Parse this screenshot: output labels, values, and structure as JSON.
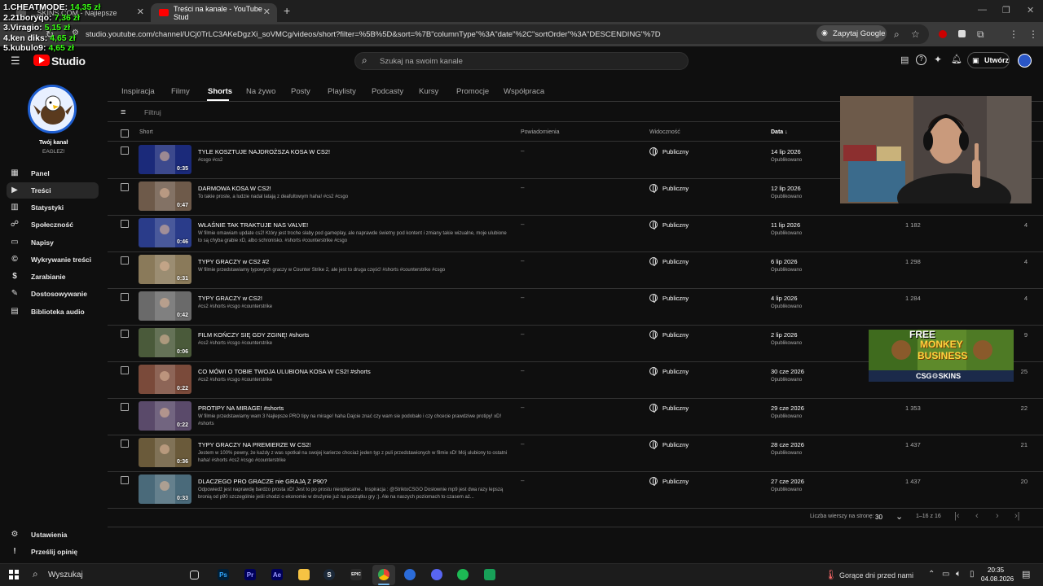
{
  "browser": {
    "tabs": [
      {
        "label": "...SKINS.COM - Najlepsze"
      },
      {
        "label": "Treści na kanale - YouTube Stud"
      }
    ],
    "new_tab": "+",
    "url": "studio.youtube.com/channel/UCj0TrLC3AKeDgzXi_soVMCg/videos/short?filter=%5B%5D&sort=%7B\"columnType\"%3A\"date\"%2C\"sortOrder\"%3A\"DESCENDING\"%7D",
    "ask_google": "Zapytaj Google"
  },
  "leaderboard": [
    {
      "rank_name": "1.CHEATMODE:",
      "amount": "14,35 zł"
    },
    {
      "rank_name": "2.21boryqo:",
      "amount": "7,36 zł"
    },
    {
      "rank_name": "3.Viragio:",
      "amount": "5,15 zł"
    },
    {
      "rank_name": "4.ken diks:",
      "amount": "4,65 zł"
    },
    {
      "rank_name": "5.kubulo9:",
      "amount": "4,65 zł"
    }
  ],
  "header": {
    "logo_text": "Studio",
    "search_placeholder": "Szukaj na swoim kanale",
    "create_label": "Utwórz"
  },
  "channel": {
    "label": "Twój kanał",
    "name": "EAGLEZ!"
  },
  "sidebar": {
    "items": [
      {
        "label": "Panel",
        "icon": "dashboard-icon"
      },
      {
        "label": "Treści",
        "icon": "content-icon",
        "active": true
      },
      {
        "label": "Statystyki",
        "icon": "analytics-icon"
      },
      {
        "label": "Społeczność",
        "icon": "community-icon"
      },
      {
        "label": "Napisy",
        "icon": "subtitles-icon"
      },
      {
        "label": "Wykrywanie treści",
        "icon": "copyright-icon"
      },
      {
        "label": "Zarabianie",
        "icon": "monetization-icon"
      },
      {
        "label": "Dostosowywanie",
        "icon": "customization-icon"
      },
      {
        "label": "Biblioteka audio",
        "icon": "audio-library-icon"
      }
    ],
    "bottom": [
      {
        "label": "Ustawienia",
        "icon": "settings-icon"
      },
      {
        "label": "Prześlij opinię",
        "icon": "feedback-icon"
      }
    ]
  },
  "content_tabs": [
    "Inspiracja",
    "Filmy",
    "Shorts",
    "Na żywo",
    "Posty",
    "Playlisty",
    "Podcasty",
    "Kursy",
    "Promocje",
    "Współpraca"
  ],
  "filter_placeholder": "Filtruj",
  "table": {
    "columns": {
      "short": "Short",
      "notifications": "Powiadomienia",
      "visibility": "Widoczność",
      "date": "Data ↓"
    },
    "rows": [
      {
        "title": "TYLE KOSZTUJE NAJDROŻSZA KOSA W CS2!",
        "desc": "#csgo #cs2",
        "duration": "0:35",
        "notif": "–",
        "visibility": "Publiczny",
        "date": "14 lip 2026",
        "status": "Opublikowano",
        "views": "",
        "comments": ""
      },
      {
        "title": "DARMOWA KOSA W CS2!",
        "desc": "To takie proste, a ludzie nadal latają z deafultowym haha! #cs2 #csgo",
        "duration": "0:47",
        "notif": "–",
        "visibility": "Publiczny",
        "date": "12 lip 2026",
        "status": "Opublikowano",
        "views": "",
        "comments": ""
      },
      {
        "title": "WŁAŚNIE TAK TRAKTUJE NAS VALVE!",
        "desc": "W filmie omawiam update cs2! Który jest troche słaby pod gameplay, ale naprawde świetny pod kontent i zmiany takie wizualne, moje ulubione to są chyba grabie xD, albo schronisko. #shorts #counterstrike #csgo",
        "duration": "0:46",
        "notif": "–",
        "visibility": "Publiczny",
        "date": "11 lip 2026",
        "status": "Opublikowano",
        "views": "1 182",
        "comments": "4"
      },
      {
        "title": "TYPY GRACZY w CS2 #2",
        "desc": "W filmie przedstawiamy typowych graczy w Counter Strike 2, ale jest to druga część! #shorts #counterstrike #csgo",
        "duration": "0:31",
        "notif": "–",
        "visibility": "Publiczny",
        "date": "6 lip 2026",
        "status": "Opublikowano",
        "views": "1 298",
        "comments": "4"
      },
      {
        "title": "TYPY GRACZY w CS2!",
        "desc": "#cs2 #shorts #csgo #counterstrike",
        "duration": "0:42",
        "notif": "–",
        "visibility": "Publiczny",
        "date": "4 lip 2026",
        "status": "Opublikowano",
        "views": "1 284",
        "comments": "4"
      },
      {
        "title": "FILM KOŃCZY SIĘ GDY ZGINĘ! #shorts",
        "desc": "#cs2 #shorts #csgo #counterstrike",
        "duration": "0:06",
        "notif": "–",
        "visibility": "Publiczny",
        "date": "2 lip 2026",
        "status": "Opublikowano",
        "views": "",
        "comments": "9"
      },
      {
        "title": "CO MÓWI O TOBIE TWOJA ULUBIONA KOSA W CS2! #shorts",
        "desc": "#cs2 #shorts #csgo #counterstrike",
        "duration": "0:22",
        "notif": "–",
        "visibility": "Publiczny",
        "date": "30 cze 2026",
        "status": "Opublikowano",
        "views": "",
        "comments": "25"
      },
      {
        "title": "PROTIPY NA MIRAGE! #shorts",
        "desc": "W filmie przedstawiamy wam 3 Najlepsze PRO tipy na mirage! haha Dajcie znać czy wam sie podobało i czy chcecie prawdziwe protipy! xD! #shorts",
        "duration": "0:22",
        "notif": "–",
        "visibility": "Publiczny",
        "date": "29 cze 2026",
        "status": "Opublikowano",
        "views": "1 353",
        "comments": "22"
      },
      {
        "title": "TYPY GRACZY NA PREMIERZE W CS2!",
        "desc": "Jestem w 100% pewny, że każdy z was spotkał na swojej karierze chociaż jeden typ z puli przedstawionych w filmie xD! Mój ulubiony to ostatni haha! #shorts #cs2 #csgo #counterstrike",
        "duration": "0:36",
        "notif": "–",
        "visibility": "Publiczny",
        "date": "28 cze 2026",
        "status": "Opublikowano",
        "views": "1 437",
        "comments": "21"
      },
      {
        "title": "DLACZEGO PRO GRACZE nie GRAJĄ Z P90?",
        "desc": "Odpowiedź jest naprawdę bardzo prosta xD! Jest to po prostu nieopłacalne.. Inspiracja : @StriktoCSGO Dosłownie mp9 jest dwa razy lepszą bronią od p90 szczególnie jeśli chodzi o ekonomie w drużynie już na początku gry ;). Ale na naszych poziomach to czasem aż...",
        "duration": "0:33",
        "notif": "–",
        "visibility": "Publiczny",
        "date": "27 cze 2026",
        "status": "Opublikowano",
        "views": "1 437",
        "comments": "20"
      }
    ]
  },
  "pagination": {
    "rows_label": "Liczba wierszy na stronę:",
    "rows_value": "30",
    "range": "1–16 z 16"
  },
  "promo": {
    "line1": "FREE",
    "line2": "MONKEY",
    "line3": "BUSINESS",
    "brand": "CSG⚙SKINS"
  },
  "taskbar": {
    "search": "Wyszukaj",
    "weather": "Gorące dni przed nami",
    "time": "20:35",
    "date": "04.08.2026"
  }
}
